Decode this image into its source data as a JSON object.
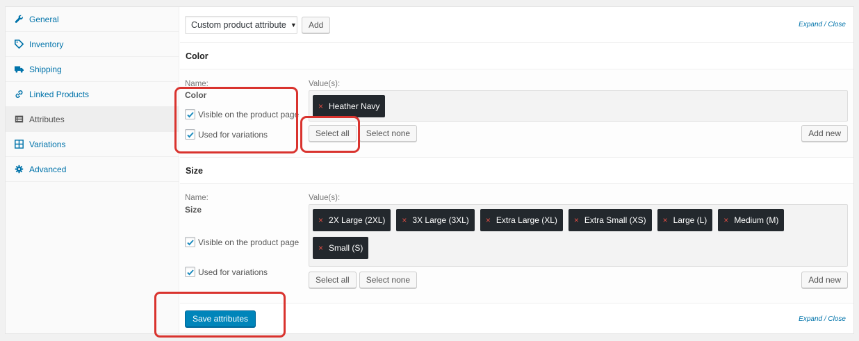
{
  "sidebar": {
    "items": [
      {
        "label": "General",
        "icon": "wrench-icon",
        "active": false
      },
      {
        "label": "Inventory",
        "icon": "tag-icon",
        "active": false
      },
      {
        "label": "Shipping",
        "icon": "truck-icon",
        "active": false
      },
      {
        "label": "Linked Products",
        "icon": "link-icon",
        "active": false
      },
      {
        "label": "Attributes",
        "icon": "list-icon",
        "active": true
      },
      {
        "label": "Variations",
        "icon": "grid-icon",
        "active": false
      },
      {
        "label": "Advanced",
        "icon": "gear-icon",
        "active": false
      }
    ]
  },
  "toolbar": {
    "select_value": "Custom product attribute",
    "add_label": "Add",
    "expand_label": "Expand",
    "separator": " / ",
    "close_label": "Close"
  },
  "attributes": [
    {
      "title": "Color",
      "name_label": "Name:",
      "name_value": "Color",
      "values_label": "Value(s):",
      "values": [
        "Heather Navy"
      ],
      "visible_label": "Visible on the product page",
      "visible_checked": true,
      "variations_label": "Used for variations",
      "variations_checked": true,
      "select_all_label": "Select all",
      "select_none_label": "Select none",
      "add_new_label": "Add new"
    },
    {
      "title": "Size",
      "name_label": "Name:",
      "name_value": "Size",
      "values_label": "Value(s):",
      "values": [
        "2X Large (2XL)",
        "3X Large (3XL)",
        "Extra Large (XL)",
        "Extra Small (XS)",
        "Large (L)",
        "Medium (M)",
        "Small (S)"
      ],
      "visible_label": "Visible on the product page",
      "visible_checked": true,
      "variations_label": "Used for variations",
      "variations_checked": true,
      "select_all_label": "Select all",
      "select_none_label": "Select none",
      "add_new_label": "Add new"
    }
  ],
  "footer": {
    "save_label": "Save attributes",
    "expand_label": "Expand",
    "separator": " / ",
    "close_label": "Close"
  },
  "colors": {
    "link": "#0073aa",
    "primary_button": "#0085ba",
    "chip_bg": "#23282d",
    "chip_remove": "#e14d43",
    "highlight": "#d9332e"
  }
}
